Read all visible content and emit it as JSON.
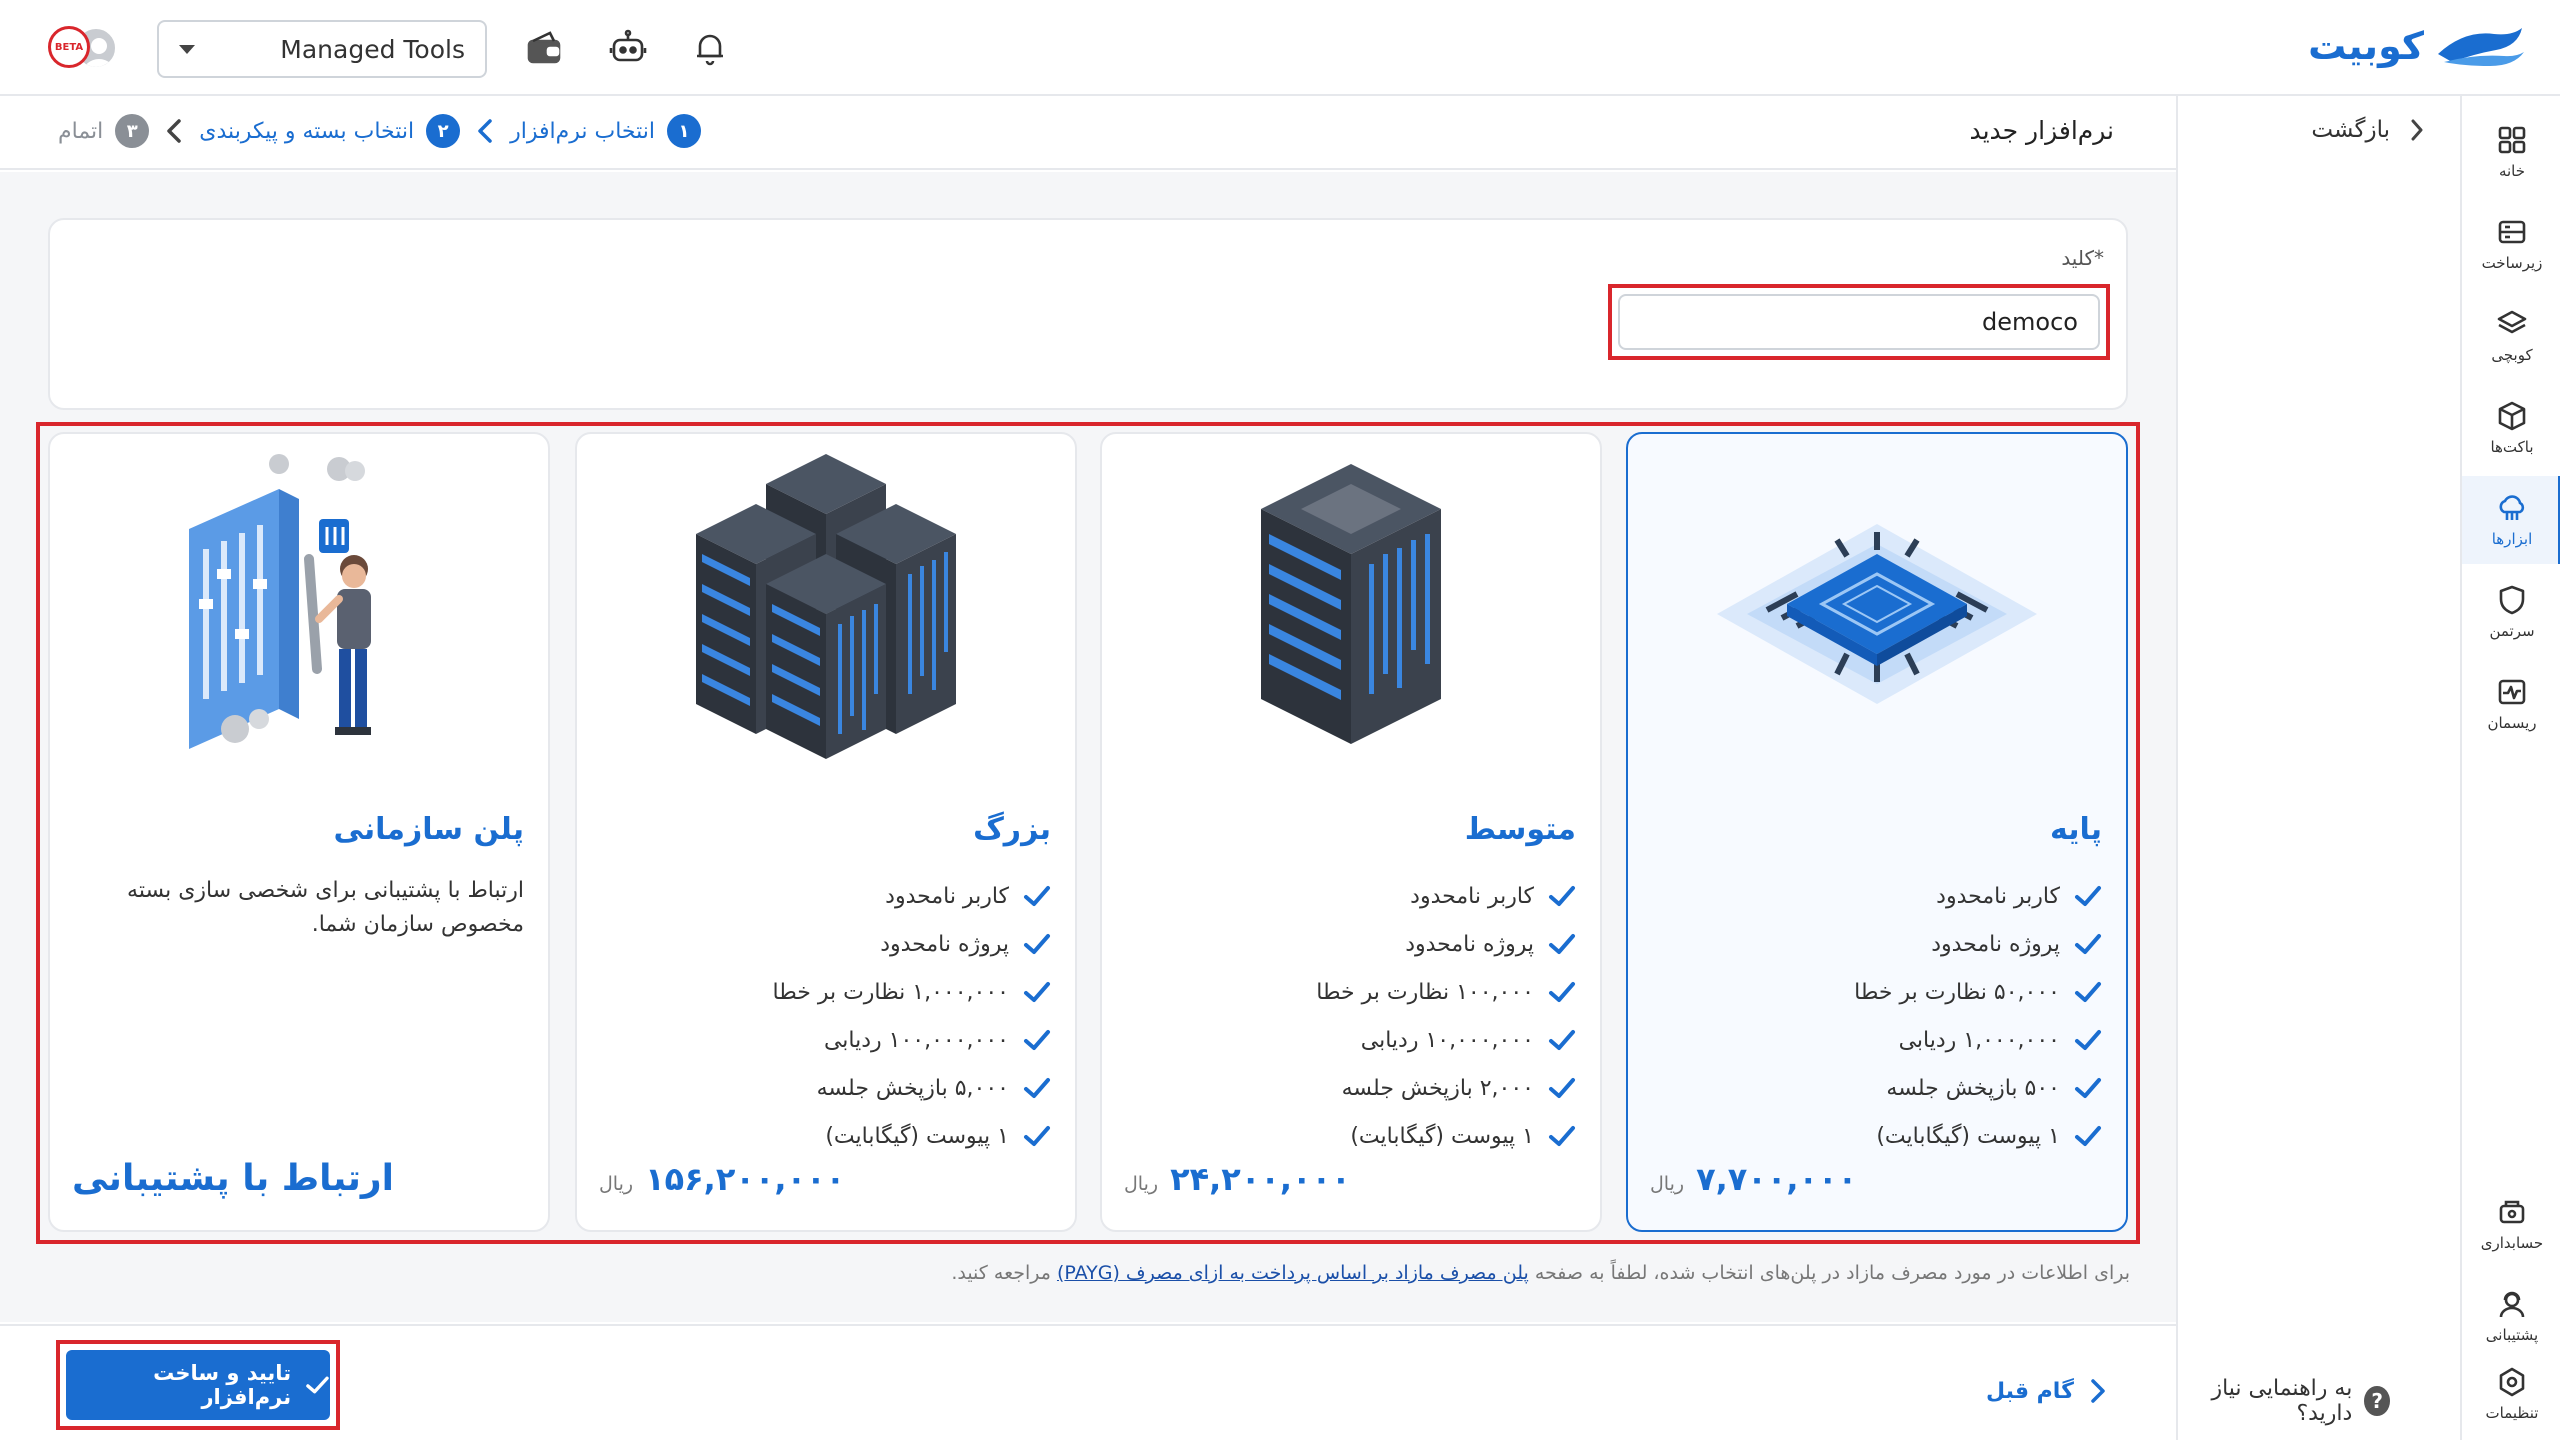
{
  "brand": {
    "name": "کوبیت",
    "color": "#1a6dd0"
  },
  "topbar": {
    "project_select_value": "Managed Tools",
    "icons": [
      "wallet-icon",
      "bot-icon",
      "bell-icon"
    ],
    "avatar_badge": "BETA"
  },
  "sidebar": {
    "items": [
      {
        "label": "خانه",
        "icon": "grid-icon"
      },
      {
        "label": "زیرساخت",
        "icon": "server-icon"
      },
      {
        "label": "کوبچی",
        "icon": "layers-icon"
      },
      {
        "label": "باکت‌ها",
        "icon": "box-icon"
      },
      {
        "label": "ابزارها",
        "icon": "cloud-tools-icon",
        "active": true
      },
      {
        "label": "سرتمن",
        "icon": "shield-icon"
      },
      {
        "label": "ریسمان",
        "icon": "pulse-icon"
      }
    ],
    "bottom_items": [
      {
        "label": "حسابداری",
        "icon": "accounting-icon"
      },
      {
        "label": "پشتیبانی",
        "icon": "support-icon"
      },
      {
        "label": "تنظیمات",
        "icon": "settings-icon"
      }
    ]
  },
  "backpanel": {
    "back_label": "بازگشت",
    "help_label": "به راهنمایی نیاز دارید؟",
    "help_icon": "?"
  },
  "header": {
    "title": "نرم‌افزار جدید",
    "steps": [
      {
        "num": "۱",
        "label": "انتخاب نرم‌افزار",
        "state": "done"
      },
      {
        "num": "۲",
        "label": "انتخاب بسته و پیکربندی",
        "state": "current"
      },
      {
        "num": "۳",
        "label": "اتمام",
        "state": "pending"
      }
    ]
  },
  "key_field": {
    "label": "کلید*",
    "value": "democo"
  },
  "plans": [
    {
      "title": "پایه",
      "selected": true,
      "features": [
        "کاربر نامحدود",
        "پروژه نامحدود",
        "۵۰,۰۰۰ نظارت بر خطا",
        "۱,۰۰۰,۰۰۰ ردیابی",
        "۵۰۰ بازپخش جلسه",
        "۱ پیوست (گیگابایت)"
      ],
      "price": "۷,۷۰۰,۰۰۰",
      "unit": "ریال"
    },
    {
      "title": "متوسط",
      "selected": false,
      "features": [
        "کاربر نامحدود",
        "پروژه نامحدود",
        "۱۰۰,۰۰۰ نظارت بر خطا",
        "۱۰,۰۰۰,۰۰۰ ردیابی",
        "۲,۰۰۰ بازپخش جلسه",
        "۱ پیوست (گیگابایت)"
      ],
      "price": "۲۴,۲۰۰,۰۰۰",
      "unit": "ریال"
    },
    {
      "title": "بزرگ",
      "selected": false,
      "features": [
        "کاربر نامحدود",
        "پروژه نامحدود",
        "۱,۰۰۰,۰۰۰ نظارت بر خطا",
        "۱۰۰,۰۰۰,۰۰۰ ردیابی",
        "۵,۰۰۰ بازپخش جلسه",
        "۱ پیوست (گیگابایت)"
      ],
      "price": "۱۵۶,۲۰۰,۰۰۰",
      "unit": "ریال"
    },
    {
      "title": "پلن سازمانی",
      "selected": false,
      "description": "ارتباط با پشتیبانی برای شخصی سازی بسته مخصوص سازمان شما.",
      "contact_label": "ارتباط با پشتیبانی"
    }
  ],
  "payg_note": {
    "prefix": "برای اطلاعات در مورد مصرف مازاد در پلن‌های انتخاب شده، لطفاً به صفحه",
    "link": "پلن مصرف مازاد بر اساس پرداخت به ازای مصرف (PAYG)",
    "suffix": "مراجعه کنید."
  },
  "footer": {
    "prev_label": "گام قبل",
    "confirm_label": "تایید و ساخت نرم‌افزار"
  }
}
